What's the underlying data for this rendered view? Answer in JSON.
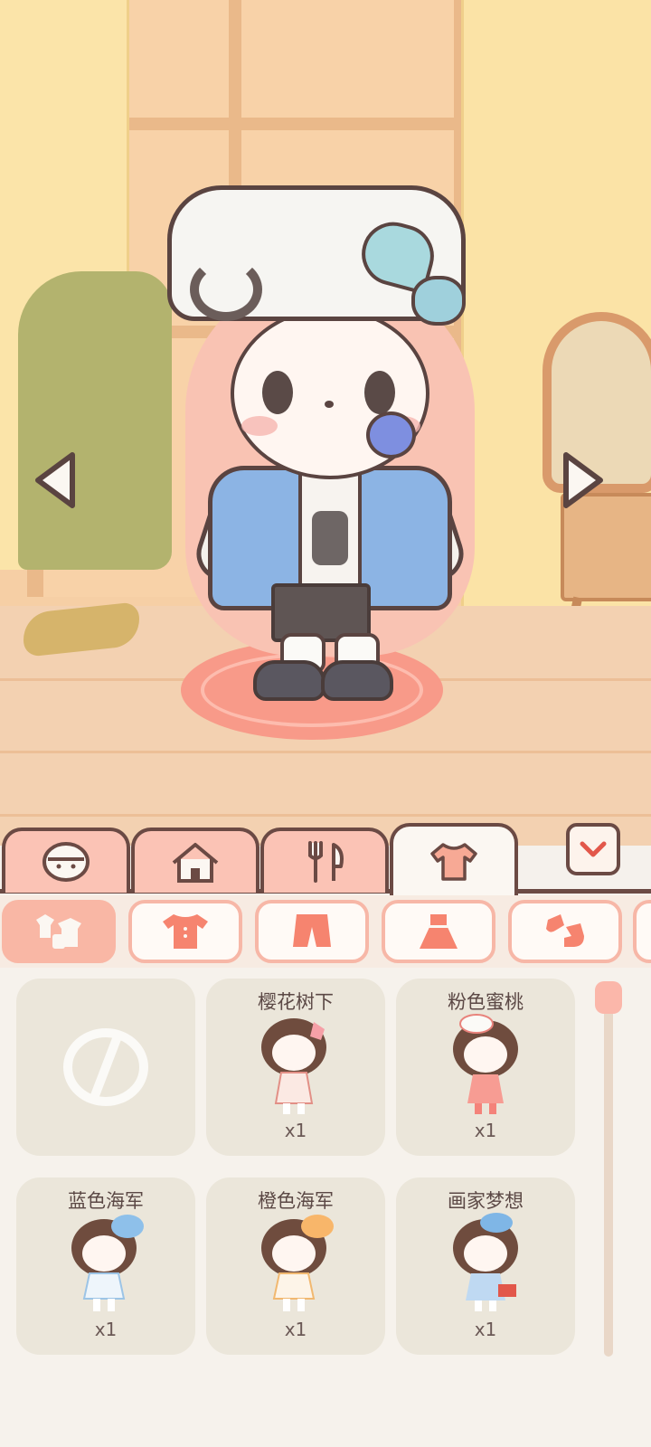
{
  "scene": {
    "left_arrow_icon": "triangle-left",
    "right_arrow_icon": "triangle-right"
  },
  "main_tabs": [
    {
      "icon": "face-icon",
      "active": false
    },
    {
      "icon": "house-icon",
      "active": false
    },
    {
      "icon": "fork-knife-icon",
      "active": false
    },
    {
      "icon": "shirt-icon",
      "active": true
    }
  ],
  "collapse_icon": "chevron-down",
  "sub_categories": [
    {
      "icon": "outfit-set-icon",
      "active": true
    },
    {
      "icon": "top-icon",
      "active": false
    },
    {
      "icon": "shorts-icon",
      "active": false
    },
    {
      "icon": "dress-icon",
      "active": false
    },
    {
      "icon": "socks-icon",
      "active": false
    }
  ],
  "items": [
    {
      "name": "",
      "qty": "",
      "icon": "none-icon"
    },
    {
      "name": "樱花树下",
      "qty": "x1"
    },
    {
      "name": "粉色蜜桃",
      "qty": "x1"
    },
    {
      "name": "蓝色海军",
      "qty": "x1"
    },
    {
      "name": "橙色海军",
      "qty": "x1"
    },
    {
      "name": "画家梦想",
      "qty": "x1"
    }
  ],
  "colors": {
    "accent": "#f9b7a5",
    "outline": "#6b4a44",
    "card": "#ebe6da",
    "background": "#f6f2ec"
  }
}
